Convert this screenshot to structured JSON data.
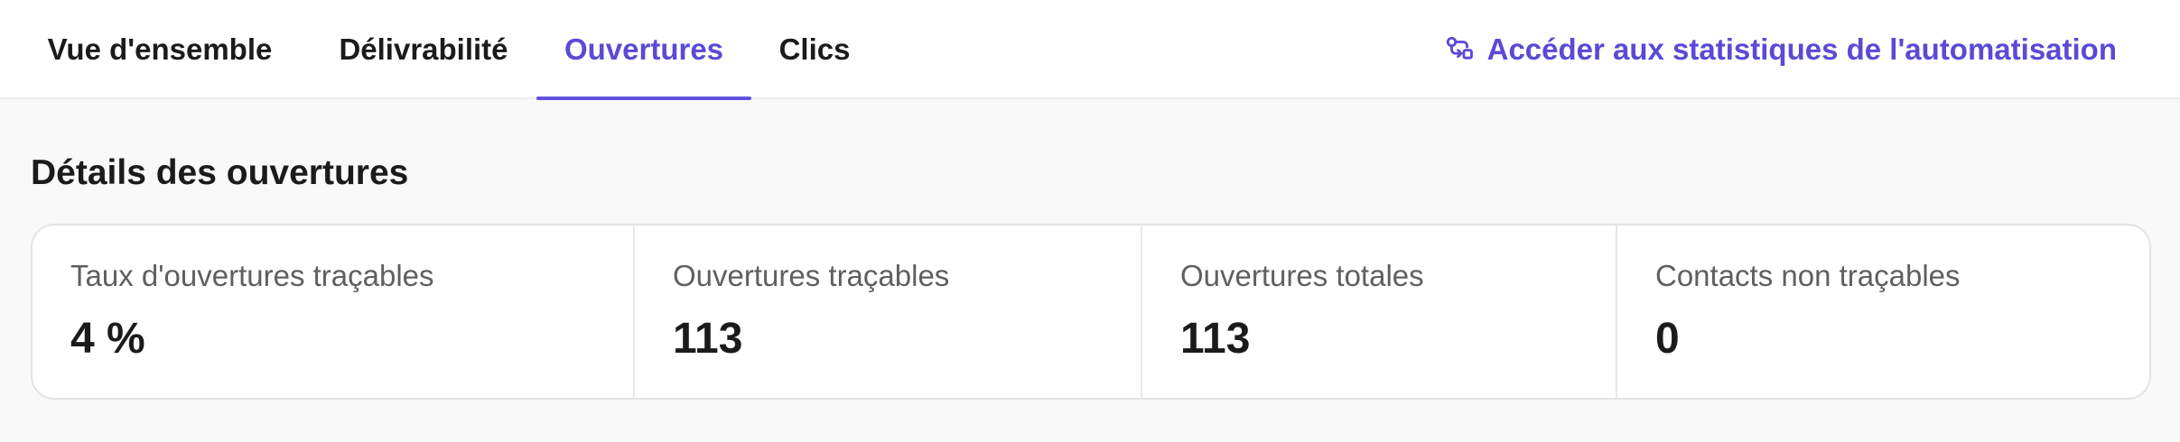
{
  "tabs": [
    {
      "label": "Vue d'ensemble",
      "active": false
    },
    {
      "label": "Délivrabilité",
      "active": false
    },
    {
      "label": "Ouvertures",
      "active": true
    },
    {
      "label": "Clics",
      "active": false
    }
  ],
  "header_link": {
    "label": "Accéder aux statistiques de l'automatisation",
    "icon": "workflow-icon"
  },
  "section": {
    "title": "Détails des ouvertures"
  },
  "stats": [
    {
      "label": "Taux d'ouvertures traçables",
      "value": "4 %"
    },
    {
      "label": "Ouvertures traçables",
      "value": "113"
    },
    {
      "label": "Ouvertures totales",
      "value": "113"
    },
    {
      "label": "Contacts non traçables",
      "value": "0"
    }
  ],
  "colors": {
    "accent": "#5a4ad6",
    "text": "#1b1b1b",
    "muted": "#5f5f5f",
    "background": "#f9f9f9",
    "card": "#ffffff"
  }
}
